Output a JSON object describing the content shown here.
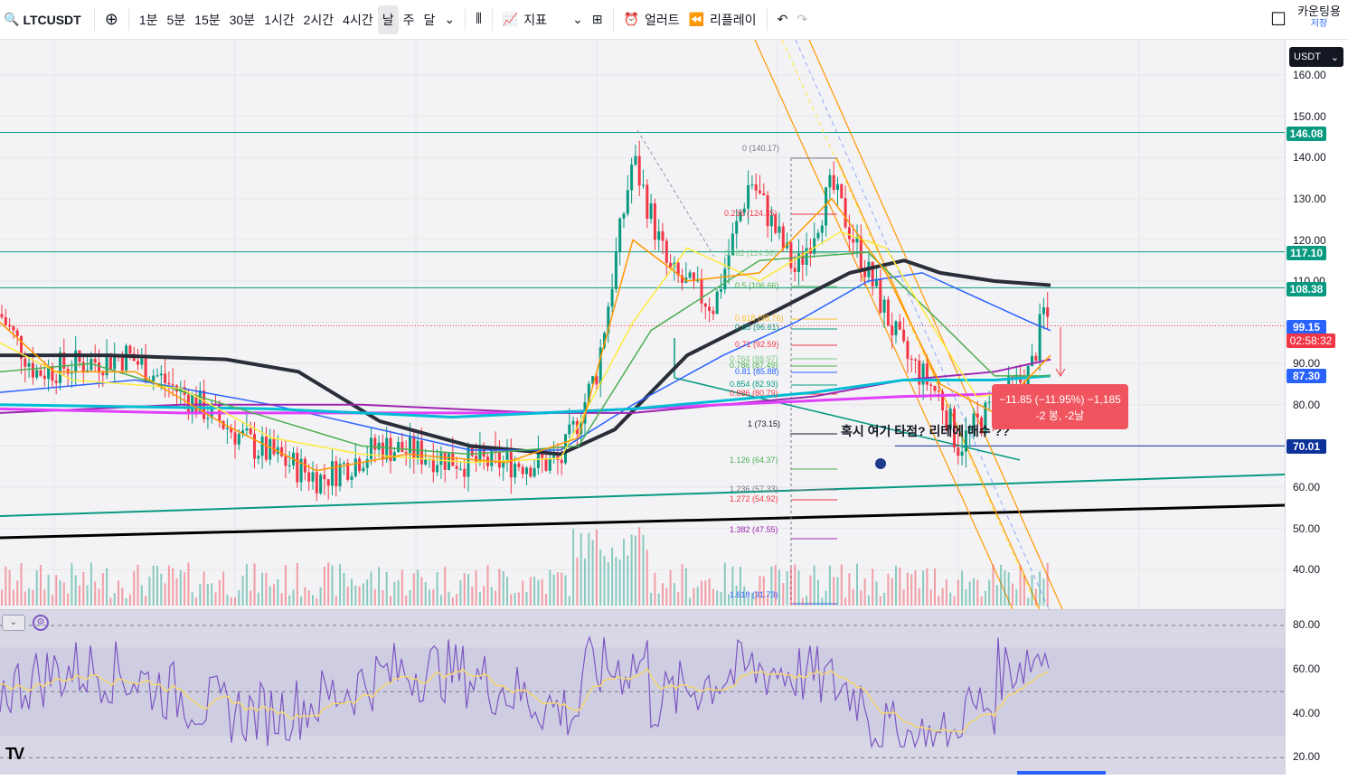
{
  "toolbar": {
    "symbol": "LTCUSDT",
    "intervals": [
      "1분",
      "5분",
      "15분",
      "30분",
      "1시간",
      "2시간",
      "4시간",
      "날",
      "주",
      "달"
    ],
    "active_interval": "날",
    "indicators_label": "지표",
    "alert_label": "얼러트",
    "replay_label": "리플레이",
    "account_label": "카운팅용",
    "save_label": "저장"
  },
  "price_scale": {
    "currency": "USDT",
    "ticks": [
      "160.00",
      "150.00",
      "140.00",
      "130.00",
      "120.00",
      "110.00",
      "90.00",
      "80.00",
      "70.00",
      "60.00",
      "50.00",
      "40.00"
    ],
    "labels": [
      {
        "value": "146.08",
        "color": "#089981"
      },
      {
        "value": "117.10",
        "color": "#089981"
      },
      {
        "value": "108.38",
        "color": "#089981"
      },
      {
        "value": "99.15",
        "color": "#2962ff"
      },
      {
        "value": "02:58:32",
        "color": "#f23645"
      },
      {
        "value": "87.30",
        "color": "#2962ff"
      },
      {
        "value": "70.01",
        "color": "#0c3299"
      }
    ]
  },
  "position_tool": {
    "line1": "−11.85 (−11.95%) −1,185",
    "line2": "-2 봉, -2날"
  },
  "annotation": "혹시 여기 타점? 리테에 매수 ??",
  "fib_levels": [
    {
      "label": "0 (140.17)",
      "color": "#787b86"
    },
    {
      "label": "0.236 (124.35)",
      "color": "#f23645"
    },
    {
      "label": "0.382 (114.56)",
      "color": "#81c784"
    },
    {
      "label": "0.5 (106.66)",
      "color": "#4caf50"
    },
    {
      "label": "0.618 (98.76)",
      "color": "#fbc02d"
    },
    {
      "label": "0.65 (96.61)",
      "color": "#089981"
    },
    {
      "label": "0.71 (92.59)",
      "color": "#f23645"
    },
    {
      "label": "0.764 (88.97)",
      "color": "#81c784"
    },
    {
      "label": "0.786 (87.49)",
      "color": "#4caf50"
    },
    {
      "label": "0.81 (85.88)",
      "color": "#2962ff"
    },
    {
      "label": "0.854 (82.93)",
      "color": "#089981"
    },
    {
      "label": "0.886 (80.79)",
      "color": "#f23645"
    },
    {
      "label": "1 (73.15)",
      "color": "#131722"
    },
    {
      "label": "1.126 (64.37)",
      "color": "#4caf50"
    },
    {
      "label": "1.236 (57.33)",
      "color": "#787b86"
    },
    {
      "label": "1.272 (54.92)",
      "color": "#f23645"
    },
    {
      "label": "1.382 (47.55)",
      "color": "#9c27b0"
    },
    {
      "label": "1.618 (31.73)",
      "color": "#2962ff"
    }
  ],
  "rsi": {
    "ticks": [
      "80.00",
      "60.00",
      "40.00",
      "20.00"
    ]
  },
  "colors": {
    "up": "#089981",
    "down": "#f23645",
    "ma_black": "#2a2e39",
    "ma_blue": "#2962ff",
    "ma_green": "#4caf50",
    "ma_yellow": "#ffeb3b",
    "ma_orange": "#ff9800",
    "ma_purple": "#9c27b0",
    "ma_magenta": "#e040fb",
    "ma_cyan": "#00bcd4",
    "rsi": "#7e57c2"
  }
}
